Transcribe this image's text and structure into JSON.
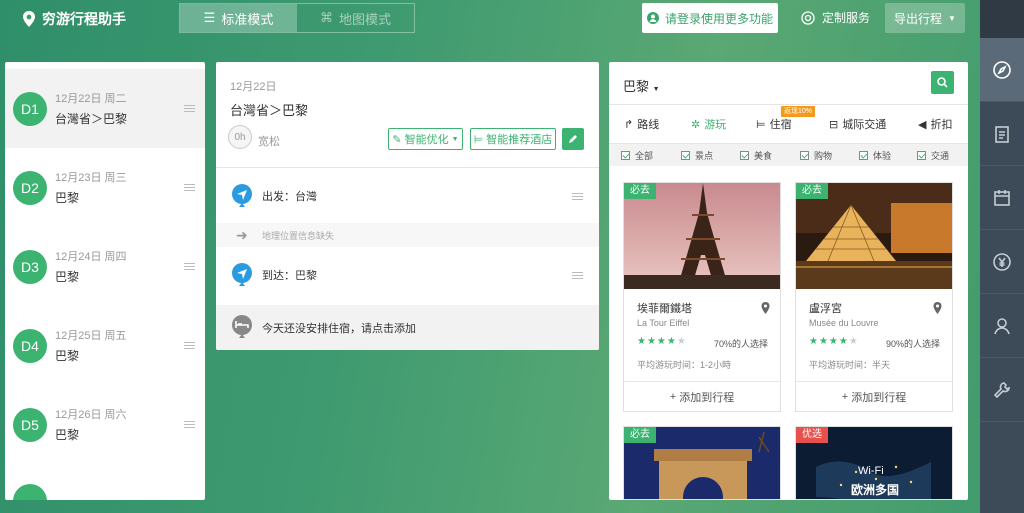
{
  "app": {
    "title": "穷游行程助手"
  },
  "modes": [
    {
      "label": "标准模式",
      "active": true
    },
    {
      "label": "地图模式",
      "active": false
    }
  ],
  "header": {
    "login_label": "请登录使用更多功能",
    "custom_label": "定制服务",
    "export_label": "导出行程"
  },
  "days": [
    {
      "badge": "D1",
      "date": "12月22日 周二",
      "city": "台灣省＞巴黎"
    },
    {
      "badge": "D2",
      "date": "12月23日 周三",
      "city": "巴黎"
    },
    {
      "badge": "D3",
      "date": "12月24日 周四",
      "city": "巴黎"
    },
    {
      "badge": "D4",
      "date": "12月25日 周五",
      "city": "巴黎"
    },
    {
      "badge": "D5",
      "date": "12月26日 周六",
      "city": "巴黎"
    }
  ],
  "detail": {
    "date": "12月22日",
    "route": "台灣省＞巴黎",
    "time_badge": "0h",
    "time_label": "宽松",
    "optimize_label": "智能优化",
    "hotel_recommend_label": "智能推荐酒店",
    "depart": "出发：台灣",
    "missing": "地理位置信息缺失",
    "arrive": "到达：巴黎",
    "hotel_prompt": "今天还没安排住宿，请点击添加"
  },
  "poi": {
    "city": "巴黎",
    "tabs": [
      {
        "label": "路线",
        "icon": "route-icon"
      },
      {
        "label": "游玩",
        "icon": "play-icon"
      },
      {
        "label": "住宿",
        "icon": "bed-icon"
      },
      {
        "label": "城际交通",
        "icon": "transit-icon"
      },
      {
        "label": "折扣",
        "icon": "discount-icon"
      }
    ],
    "hot_badge": "返现10%",
    "filters": [
      "全部",
      "景点",
      "美食",
      "购物",
      "体验",
      "交通"
    ],
    "cards": [
      {
        "tag": "必去",
        "tag_color": "#3cb371",
        "name": "埃菲爾鐵塔",
        "en": "La Tour Eiffel",
        "rating": 4,
        "pct": "70%的人选择",
        "avg": "平均游玩时间：1-2小時",
        "add": "添加到行程"
      },
      {
        "tag": "必去",
        "tag_color": "#3cb371",
        "name": "盧浮宮",
        "en": "Musée du Louvre",
        "rating": 4,
        "pct": "90%的人选择",
        "avg": "平均游玩时间：半天",
        "add": "添加到行程"
      },
      {
        "tag": "必去",
        "tag_color": "#3cb371"
      },
      {
        "tag": "优选",
        "tag_color": "#e8504c",
        "overlay_line1": "Wi-Fi",
        "overlay_line2": "欧洲多国"
      }
    ]
  },
  "colors": {
    "accent": "#3cb371",
    "nav_bg": "#3d4a57",
    "hot": "#f39a1d"
  }
}
